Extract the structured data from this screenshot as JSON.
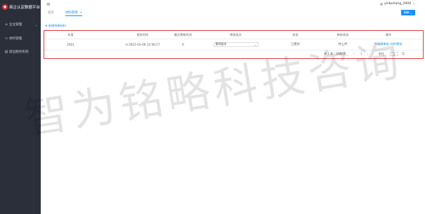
{
  "sidebar": {
    "logo_text": "商企认定数据平台",
    "items": [
      {
        "label": "企业管理",
        "icon": "building-icon"
      },
      {
        "label": "材料管理",
        "icon": "folder-icon"
      },
      {
        "label": "提出服务机构",
        "icon": "org-icon"
      }
    ]
  },
  "header": {
    "username": "yinbohang_2000"
  },
  "tabs": [
    {
      "label": "首页"
    },
    {
      "label": "材料管理"
    }
  ],
  "refresh_label": "刷新",
  "add_link": "新增待审材料",
  "table": {
    "columns": [
      "年度",
      "提交时间",
      "最近更新时间",
      "审核批次",
      "状态",
      "审核状态",
      "操作"
    ],
    "row": {
      "year": "2021",
      "submit_time": "2021-03-09 12:56:17",
      "updated": "0",
      "batch": "第四批次",
      "status": "已提交",
      "review_status": "待上传",
      "actions": [
        "编辑审核",
        "材料预览"
      ]
    }
  },
  "pagination": {
    "total": "共 1 条",
    "page_size": "10条/页",
    "current_page": "1",
    "goto_label": "前往",
    "goto_value": "1",
    "page_suffix": "页"
  },
  "watermark": "智为铭略科技咨询",
  "colors": {
    "sidebar_bg": "#2b2f3a",
    "accent": "#1890ff",
    "highlight_border": "#e03c3c"
  }
}
